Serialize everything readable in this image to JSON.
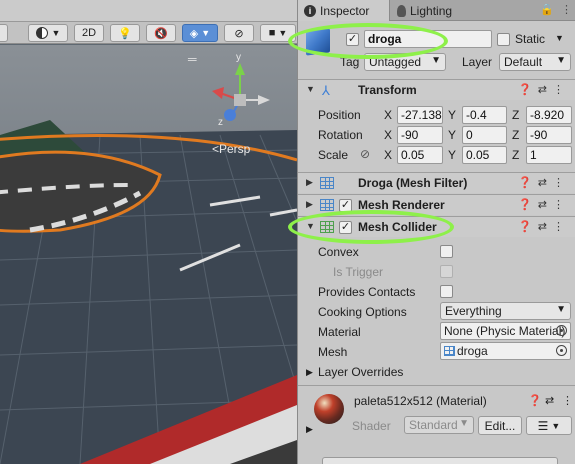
{
  "scene": {
    "toolbar": {
      "mode_2d": "2D",
      "view_label": "<Persp"
    }
  },
  "inspector": {
    "tabs": [
      {
        "label": "Inspector",
        "icon": "info-icon",
        "active": true
      },
      {
        "label": "Lighting",
        "icon": "lightbulb-icon",
        "active": false
      }
    ],
    "gameobject": {
      "enabled": true,
      "name": "droga",
      "static_label": "Static",
      "static": false,
      "tag_label": "Tag",
      "tag_value": "Untagged",
      "layer_label": "Layer",
      "layer_value": "Default"
    },
    "transform": {
      "title": "Transform",
      "position_label": "Position",
      "rotation_label": "Rotation",
      "scale_label": "Scale",
      "axis_x": "X",
      "axis_y": "Y",
      "axis_z": "Z",
      "position": {
        "x": "-27.138",
        "y": "-0.4",
        "z": "-8.920"
      },
      "rotation": {
        "x": "-90",
        "y": "0",
        "z": "-90"
      },
      "scale": {
        "x": "0.05",
        "y": "0.05",
        "z": "1"
      }
    },
    "mesh_filter": {
      "title": "Droga (Mesh Filter)"
    },
    "mesh_renderer": {
      "title": "Mesh Renderer",
      "enabled": true
    },
    "mesh_collider": {
      "title": "Mesh Collider",
      "enabled": true,
      "convex_label": "Convex",
      "is_trigger_label": "Is Trigger",
      "provides_contacts_label": "Provides Contacts",
      "cooking_options_label": "Cooking Options",
      "cooking_options_value": "Everything",
      "material_label": "Material",
      "material_value": "None (Physic Material)",
      "mesh_label": "Mesh",
      "mesh_value": "droga",
      "layer_overrides_label": "Layer Overrides"
    },
    "material": {
      "title": "paleta512x512 (Material)",
      "shader_label": "Shader",
      "shader_value": "Standard",
      "edit_label": "Edit..."
    },
    "accent_color": "#8ef04a"
  }
}
